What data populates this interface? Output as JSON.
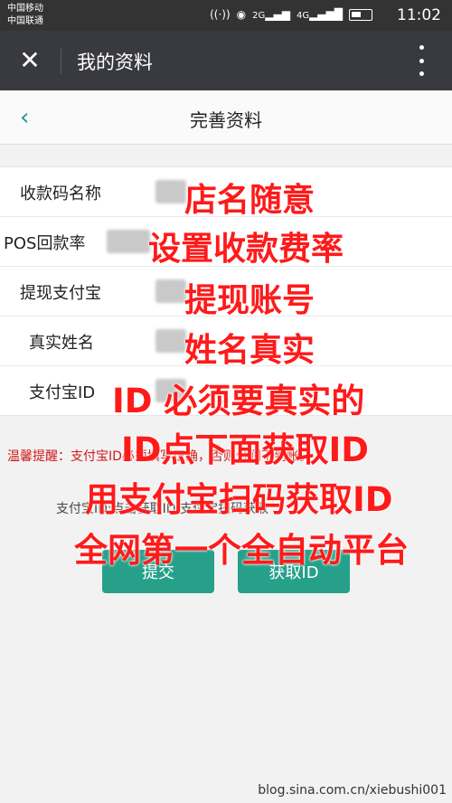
{
  "status_bar": {
    "carrier1": "中国移动",
    "carrier2": "中国联通",
    "icons": [
      "nfc-icon",
      "eye-icon",
      "signal-2g-icon",
      "signal-4g-icon",
      "battery-icon"
    ],
    "net1": "2G",
    "net2": "4G",
    "time": "11:02"
  },
  "titlebar": {
    "title": "我的资料",
    "close_glyph": "✕"
  },
  "page": {
    "title": "完善资料",
    "back_glyph": "‹"
  },
  "form": {
    "fields": [
      {
        "label": "收款码名称"
      },
      {
        "label": "POS回款率"
      },
      {
        "label": "提现支付宝"
      },
      {
        "label": "真实姓名"
      },
      {
        "label": "支付宝ID"
      }
    ]
  },
  "tip": "温馨提醒：支付宝ID必须填写正确，否则分润不到账。",
  "hint": "支付宝ID:点击获取ID,支付宝扫码获取",
  "buttons": {
    "submit": "提交",
    "get_id": "获取ID"
  },
  "overlay": {
    "lines": [
      "店名随意",
      "设置收款费率",
      "提现账号",
      "姓名真实",
      "ID  必须要真实的",
      "ID点下面获取ID",
      "用支付宝扫码获取ID",
      "全网第一个全自动平台"
    ],
    "color": "#ff1a1a"
  },
  "watermark": "blog.sina.com.cn/xiebushi001",
  "colors": {
    "accent": "#27a08a",
    "titlebar": "#393a3f",
    "tip": "#d11919"
  }
}
